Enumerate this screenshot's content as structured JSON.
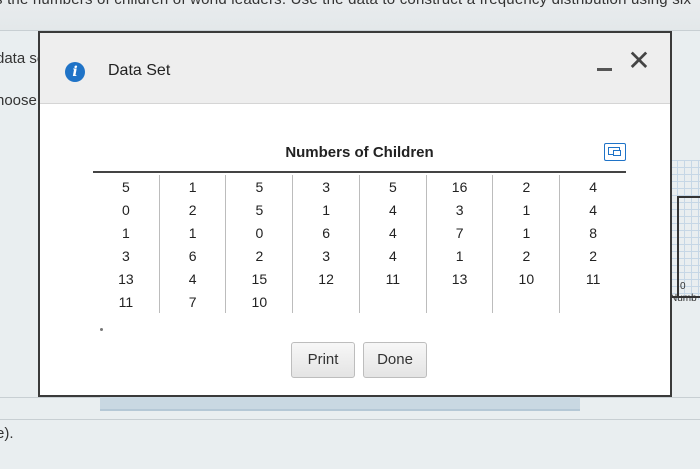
{
  "background": {
    "top_text": "s the numbers of children of world leaders. Use the data to construct a frequency distribution using six",
    "left_labels": [
      "data se",
      "hoose",
      "e)."
    ],
    "graph_axis_tick": "0",
    "graph_axis_label": "Numb"
  },
  "dialog": {
    "title": "Data Set",
    "table_title": "Numbers of Children",
    "rows": [
      [
        "5",
        "1",
        "5",
        "3",
        "5",
        "16",
        "2",
        "4"
      ],
      [
        "0",
        "2",
        "5",
        "1",
        "4",
        "3",
        "1",
        "4"
      ],
      [
        "1",
        "1",
        "0",
        "6",
        "4",
        "7",
        "1",
        "8"
      ],
      [
        "3",
        "6",
        "2",
        "3",
        "4",
        "1",
        "2",
        "2"
      ],
      [
        "13",
        "4",
        "15",
        "12",
        "11",
        "13",
        "10",
        "11"
      ],
      [
        "11",
        "7",
        "10",
        "",
        "",
        "",
        "",
        ""
      ]
    ],
    "print_label": "Print",
    "done_label": "Done"
  },
  "icons": {
    "info": "info-icon",
    "minimize": "minimize-icon",
    "close": "close-icon",
    "expand": "expand-icon"
  },
  "colors": {
    "accent": "#1f73c7"
  }
}
